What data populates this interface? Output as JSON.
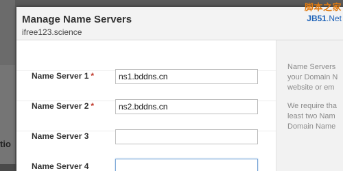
{
  "background": {
    "partial_text": "tio"
  },
  "modal": {
    "title": "Manage Name Servers",
    "subtitle": "ifree123.science"
  },
  "watermark": {
    "line1": "脚本之家",
    "jb": "JB51",
    "net": ".Net"
  },
  "form": {
    "required_marker": "*",
    "rows": [
      {
        "label": "Name Server 1",
        "value": "ns1.bddns.cn",
        "required": true
      },
      {
        "label": "Name Server 2",
        "value": "ns2.bddns.cn",
        "required": true
      },
      {
        "label": "Name Server 3",
        "value": "",
        "required": false
      },
      {
        "label": "Name Server 4",
        "value": "",
        "required": false
      }
    ]
  },
  "help": {
    "lines": [
      "Name Servers",
      "your Domain N",
      "website or em",
      "We require tha",
      "least two Nam",
      "Domain Name"
    ]
  },
  "colors": {
    "required": "#c0392b",
    "watermark_orange": "#e07a10",
    "watermark_blue": "#1f63b8"
  }
}
